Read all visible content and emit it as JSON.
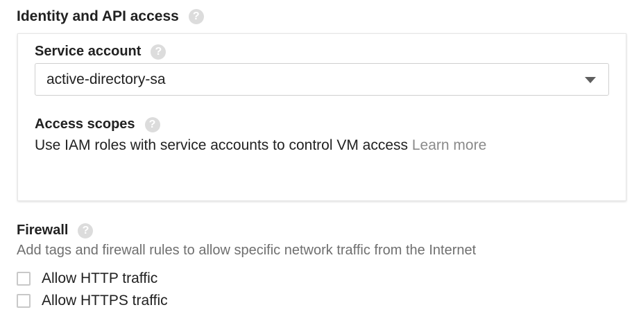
{
  "identity": {
    "title": "Identity and API access",
    "help_glyph": "?"
  },
  "service_account": {
    "label": "Service account",
    "help_glyph": "?",
    "selected_value": "active-directory-sa"
  },
  "access_scopes": {
    "label": "Access scopes",
    "help_glyph": "?",
    "description": "Use IAM roles with service accounts to control VM access",
    "learn_more": "Learn more"
  },
  "firewall": {
    "title": "Firewall",
    "help_glyph": "?",
    "description": "Add tags and firewall rules to allow specific network traffic from the Internet",
    "options": [
      {
        "label": "Allow HTTP traffic",
        "checked": false
      },
      {
        "label": "Allow HTTPS traffic",
        "checked": false
      }
    ]
  },
  "colors": {
    "help_icon_bg": "#dcdcdc",
    "link": "#8a8a8a",
    "muted_text": "#6f6f6f"
  }
}
